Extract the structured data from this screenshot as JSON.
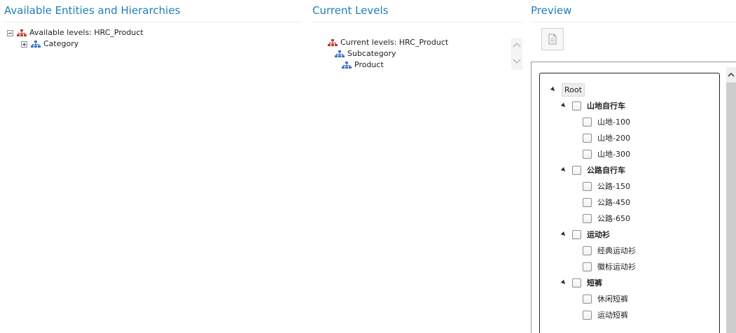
{
  "panels": {
    "available": {
      "title": "Available Entities and Hierarchies",
      "root_label": "Available levels: HRC_Product",
      "child_label": "Category"
    },
    "current": {
      "title": "Current Levels",
      "root_label": "Current levels: HRC_Product",
      "levels": [
        "Subcategory",
        "Product"
      ]
    },
    "preview": {
      "title": "Preview",
      "root": "Root",
      "groups": [
        {
          "label": "山地自行车",
          "items": [
            "山地-100",
            "山地-200",
            "山地-300"
          ]
        },
        {
          "label": "公路自行车",
          "items": [
            "公路-150",
            "公路-450",
            "公路-650"
          ]
        },
        {
          "label": "运动衫",
          "items": [
            "经典运动衫",
            "徽标运动衫"
          ]
        },
        {
          "label": "短裤",
          "items": [
            "休闲短裤",
            "运动短裤"
          ]
        }
      ]
    }
  },
  "icons": {
    "hierarchy_root": "hierarchy-red-icon",
    "hierarchy_level": "hierarchy-blue-icon",
    "preview_doc": "document-icon"
  },
  "colors": {
    "title": "#1f7fb6",
    "hier_red": "#c0392b",
    "hier_blue": "#3a6ec4"
  }
}
